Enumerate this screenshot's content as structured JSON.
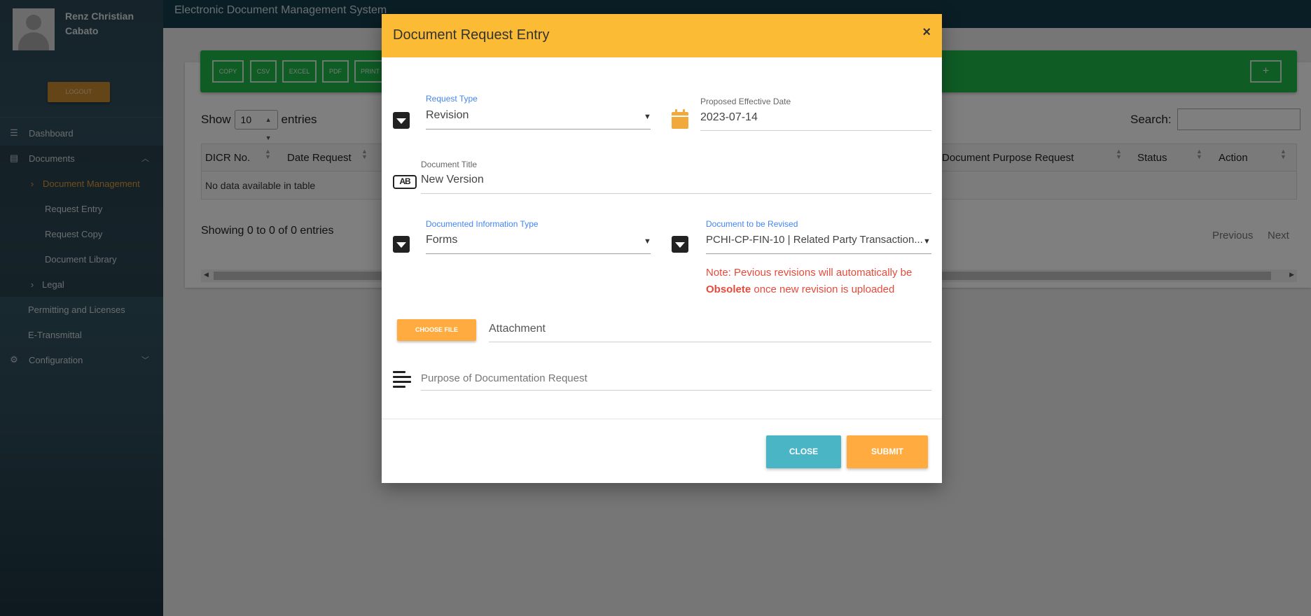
{
  "colors": {
    "sidebar_bg": "#2b4654",
    "topbar_bg": "#153d4a",
    "accent_orange": "#ffab40",
    "modal_header": "#fcbb35",
    "green_toolbar": "#1fb84b",
    "close_button": "#4ab5c4",
    "note_red": "#e64a3b",
    "label_blue": "#4285f4"
  },
  "sidebar": {
    "user_name": "Renz Christian Cabato",
    "logout_label": "LOGOUT",
    "items": [
      {
        "label": "Dashboard",
        "icon": "menu-icon"
      },
      {
        "label": "Documents",
        "icon": "list-icon"
      },
      {
        "label": "Document Management",
        "icon": "chevron-right-icon"
      },
      {
        "label": "Request Entry"
      },
      {
        "label": "Request Copy"
      },
      {
        "label": "Document Library"
      },
      {
        "label": "Legal",
        "icon": "chevron-right-icon"
      },
      {
        "label": "Permitting and Licenses"
      },
      {
        "label": "E-Transmittal"
      },
      {
        "label": "Configuration",
        "icon": "cogs-icon"
      }
    ]
  },
  "topbar": {
    "title": "Electronic Document Management System"
  },
  "toolbar": {
    "buttons": [
      "COPY",
      "CSV",
      "EXCEL",
      "PDF",
      "PRINT"
    ],
    "add_label": "+"
  },
  "table": {
    "show_label": "Show",
    "entries_value": "10",
    "entries_label": "entries",
    "search_label": "Search:",
    "columns": [
      "DICR No.",
      "Date Request",
      "Document Purpose Request",
      "Status",
      "Action"
    ],
    "empty_message": "No data available in table",
    "showing": "Showing 0 to 0 of 0 entries",
    "previous": "Previous",
    "next": "Next"
  },
  "modal": {
    "title": "Document Request Entry",
    "close_icon": "×",
    "request_type": {
      "label": "Request Type",
      "value": "Revision"
    },
    "effective_date": {
      "label": "Proposed Effective Date",
      "value": "2023-07-14"
    },
    "document_title": {
      "label": "Document Title",
      "value": "New Version"
    },
    "info_type": {
      "label": "Documented Information Type",
      "value": "Forms"
    },
    "doc_revised": {
      "label": "Document to be Revised",
      "value": "PCHI-CP-FIN-10 | Related Party Transaction..."
    },
    "note_text_1": "Note: Pevious revisions will automatically be",
    "note_obsolete": "Obsolete",
    "note_text_2": "once new revision is uploaded",
    "choose_file_label": "CHOOSE FILE",
    "attachment_placeholder": "Attachment",
    "purpose_placeholder": "Purpose of Documentation Request",
    "close_label": "CLOSE",
    "submit_label": "SUBMIT"
  }
}
